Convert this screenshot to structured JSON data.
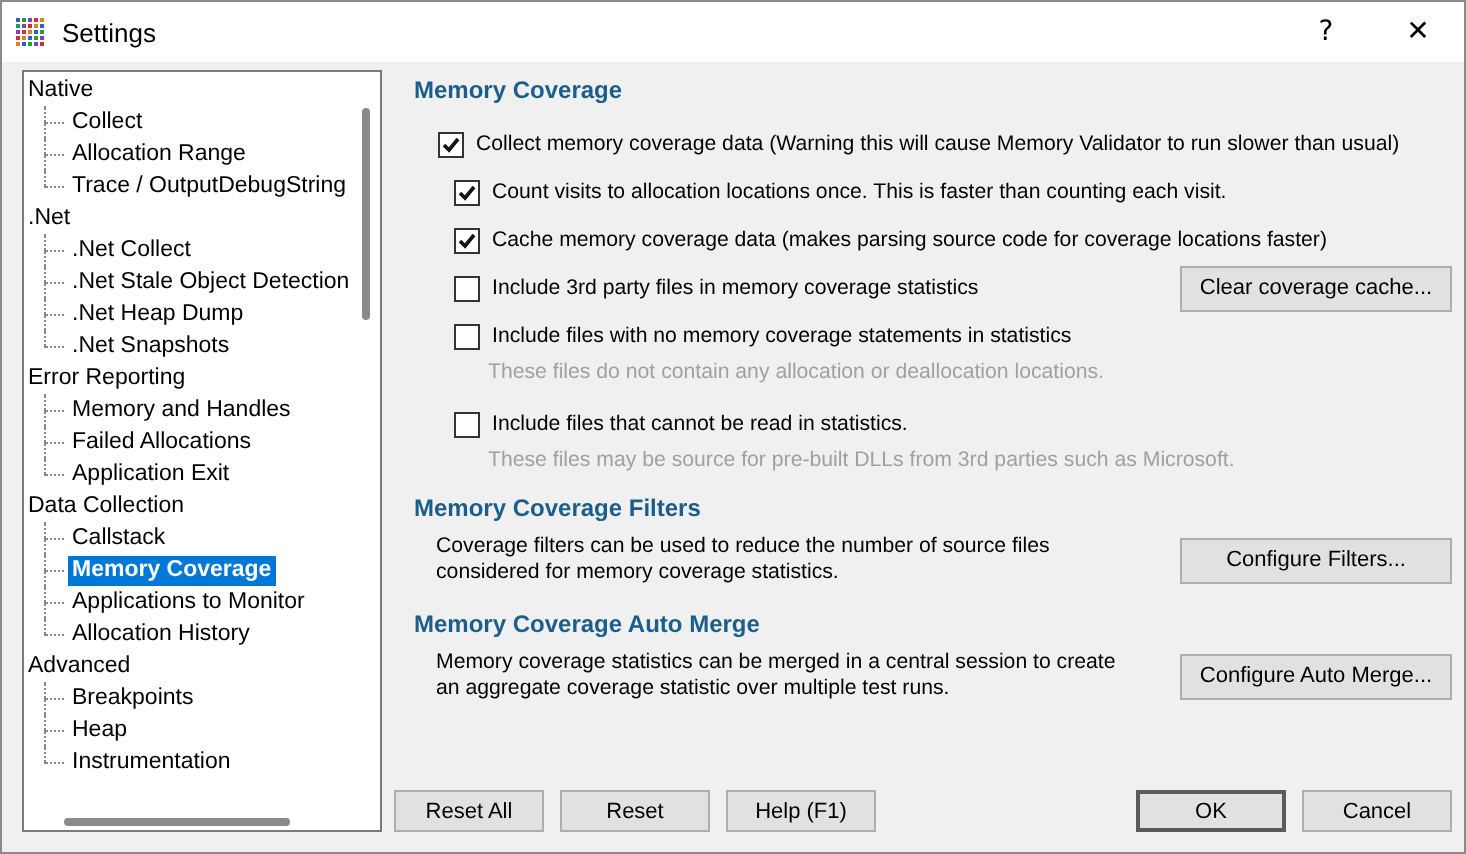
{
  "window": {
    "title": "Settings",
    "help_glyph": "?",
    "close_glyph": "✕"
  },
  "tree": [
    {
      "label": "Native",
      "children": [
        {
          "label": "Collect",
          "selected": false
        },
        {
          "label": "Allocation Range",
          "selected": false
        },
        {
          "label": "Trace / OutputDebugString",
          "selected": false
        }
      ]
    },
    {
      "label": ".Net",
      "children": [
        {
          "label": ".Net Collect",
          "selected": false
        },
        {
          "label": ".Net Stale Object Detection",
          "selected": false
        },
        {
          "label": ".Net Heap Dump",
          "selected": false
        },
        {
          "label": ".Net Snapshots",
          "selected": false
        }
      ]
    },
    {
      "label": "Error Reporting",
      "children": [
        {
          "label": "Memory and Handles",
          "selected": false
        },
        {
          "label": "Failed Allocations",
          "selected": false
        },
        {
          "label": "Application Exit",
          "selected": false
        }
      ]
    },
    {
      "label": "Data Collection",
      "children": [
        {
          "label": "Callstack",
          "selected": false
        },
        {
          "label": "Memory Coverage",
          "selected": true
        },
        {
          "label": "Applications to Monitor",
          "selected": false
        },
        {
          "label": "Allocation History",
          "selected": false
        }
      ]
    },
    {
      "label": "Advanced",
      "children": [
        {
          "label": "Breakpoints",
          "selected": false
        },
        {
          "label": "Heap",
          "selected": false
        },
        {
          "label": "Instrumentation",
          "selected": false
        }
      ]
    }
  ],
  "sections": [
    {
      "heading": "Memory Coverage",
      "options": [
        {
          "label": "Collect memory coverage data (Warning this will cause Memory Validator to run slower than usual)",
          "checked": true,
          "children": [
            {
              "label": "Count visits to allocation locations once. This is faster than counting each visit.",
              "checked": true
            },
            {
              "label": "Cache memory coverage data (makes parsing source code for coverage locations faster)",
              "checked": true
            },
            {
              "label": "Include 3rd party files in memory coverage statistics",
              "checked": false,
              "button": "Clear coverage cache..."
            },
            {
              "label": "Include files with no memory coverage statements in statistics",
              "checked": false,
              "note": "These files do not contain any allocation or deallocation locations."
            },
            {
              "label": "Include files that cannot be read in statistics.",
              "checked": false,
              "note": "These files may be source for pre-built DLLs from 3rd parties such as Microsoft."
            }
          ]
        }
      ]
    },
    {
      "heading": "Memory Coverage Filters",
      "text": "Coverage filters can be used to reduce the number of source files considered for memory coverage statistics.",
      "button": "Configure Filters..."
    },
    {
      "heading": "Memory Coverage Auto Merge",
      "text": "Memory coverage statistics can be merged in a central session to create an aggregate coverage statistic over multiple test runs.",
      "button": "Configure Auto Merge..."
    }
  ],
  "footer": {
    "left_buttons": [
      {
        "label": "Reset All",
        "default": false
      },
      {
        "label": "Reset",
        "default": false
      },
      {
        "label": "Help (F1)",
        "default": false
      }
    ],
    "right_buttons": [
      {
        "label": "OK",
        "default": true
      },
      {
        "label": "Cancel",
        "default": false
      }
    ]
  }
}
